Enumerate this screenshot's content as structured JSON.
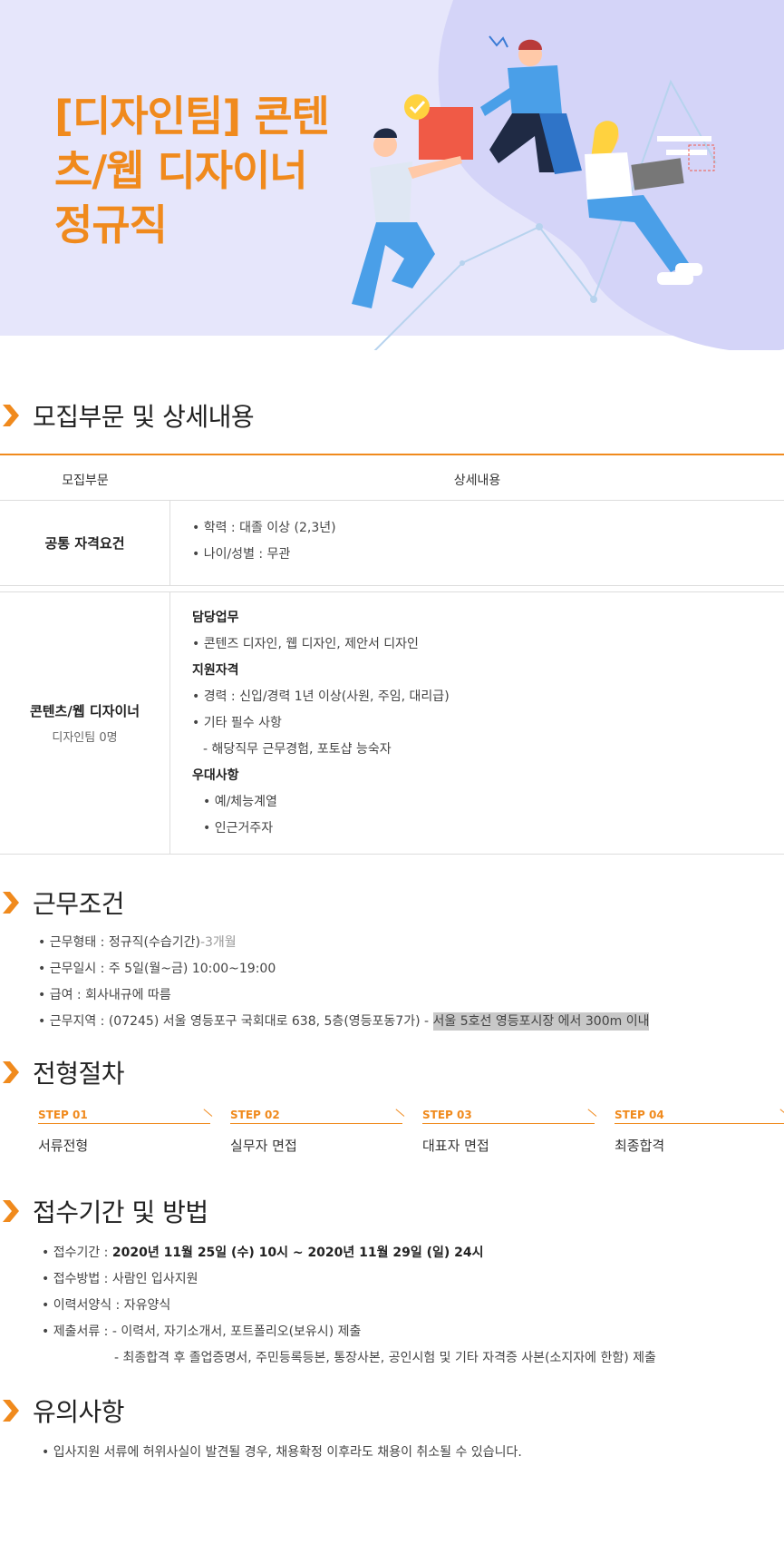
{
  "hero": {
    "title": "[디자인팀] 콘텐츠/웹 디자이너 정규직"
  },
  "section1": {
    "heading": "모집부문 및 상세내용",
    "col1": "모집부문",
    "col2": "상세내용",
    "common": {
      "name": "공통 자격요건",
      "lines": [
        "• 학력 : 대졸 이상 (2,3년)",
        "• 나이/성별 : 무관"
      ]
    },
    "position": {
      "name": "콘텐츠/웹 디자이너",
      "sub": "디자인팀 0명",
      "lines": [
        "담당업무",
        "• 콘텐즈 디자인, 웹 디자인, 제안서 디자인",
        "지원자격",
        "• 경력 : 신입/경력 1년 이상(사원, 주임, 대리급)",
        "• 기타 필수 사항",
        "  - 해당직무 근무경험, 포토샵 능숙자",
        "우대사항",
        "  • 예/체능계열",
        "  • 인근거주자"
      ]
    }
  },
  "section2": {
    "heading": "근무조건",
    "type_label": "• 근무형태 : 정규직(수습기간)",
    "type_suffix": "-3개월",
    "hours": "• 근무일시 : 주 5일(월~금) 10:00~19:00",
    "salary": "• 급여 : 회사내규에 따름",
    "location_label": "• 근무지역 : (07245) 서울 영등포구 국회대로 638, 5층(영등포동7가) - ",
    "location_note": "서울 5호선 영등포시장 에서 300m 이내"
  },
  "section3": {
    "heading": "전형절차",
    "steps": [
      {
        "label": "STEP 01",
        "name": "서류전형"
      },
      {
        "label": "STEP 02",
        "name": "실무자 면접"
      },
      {
        "label": "STEP 03",
        "name": "대표자 면접"
      },
      {
        "label": "STEP 04",
        "name": "최종합격"
      }
    ]
  },
  "section4": {
    "heading": "접수기간 및 방법",
    "period_label": "• 접수기간 : ",
    "period_value": "2020년 11월 25일 (수) 10시 ~ 2020년 11월 29일 (일) 24시",
    "method": "• 접수방법 : 사람인 입사지원",
    "format": "• 이력서양식 : 자유양식",
    "docs1": "• 제출서류 : - 이력서, 자기소개서, 포트폴리오(보유시) 제출",
    "docs2": "- 최종합격 후 졸업증명서, 주민등록등본, 통장사본, 공인시험 및 기타 자격증 사본(소지자에 한함) 제출"
  },
  "section5": {
    "heading": "유의사항",
    "note": "• 입사지원 서류에 허위사실이 발견될 경우, 채용확정 이후라도 채용이 취소될 수 있습니다."
  },
  "colors": {
    "accent": "#f08a1d",
    "hero_bg": "#e6e6fb",
    "highlight": "#c8c8c8"
  }
}
